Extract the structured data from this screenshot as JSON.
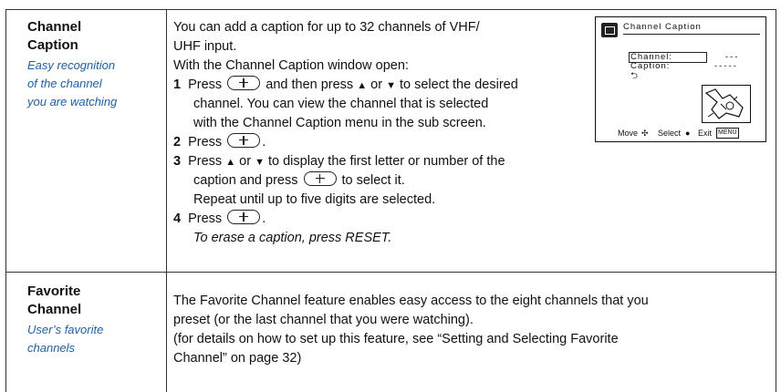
{
  "rows": [
    {
      "title_lines": [
        "Channel",
        "Caption"
      ],
      "subtitle_lines": [
        "Easy recognition",
        "of the channel",
        "you are watching"
      ],
      "intro_lines": [
        "You can add a caption for up to 32 channels of VHF/",
        "UHF input.",
        "With the Channel Caption window open:"
      ],
      "step1": {
        "num": "1",
        "press": "Press",
        "mid": "and then press",
        "or": "or",
        "end": "to select the desired",
        "line2": "channel. You can view the channel that is selected",
        "line3": "with the Channel Caption menu in the sub screen."
      },
      "step2": {
        "num": "2",
        "press": "Press",
        "end": "."
      },
      "step3": {
        "num": "3",
        "press": "Press",
        "or": "or",
        "end": "to display the first letter or number of the",
        "line2a": "caption and press",
        "line2b": "to select it.",
        "line3": "Repeat until up to five digits are selected."
      },
      "step4": {
        "num": "4",
        "press": "Press",
        "end": "."
      },
      "note": "To erase a caption, press RESET."
    },
    {
      "title_lines": [
        "Favorite",
        "Channel"
      ],
      "subtitle_lines": [
        "User’s favorite",
        "channels"
      ],
      "body_lines": [
        "The Favorite Channel feature enables easy access to the eight channels that you",
        "preset (or the last channel that you were watching).",
        "(for details on how to set up this feature, see “Setting and Selecting Favorite",
        "Channel” on page 32)"
      ]
    }
  ],
  "screen": {
    "title": "Channel Caption",
    "channel_label": "Channel:",
    "channel_value": "---",
    "caption_label": "Caption:",
    "caption_value": "-----",
    "footer_move": "Move",
    "footer_select": "Select",
    "footer_exit": "Exit",
    "footer_menu": "MENU"
  },
  "icons": [
    "enter-button-icon",
    "up-arrow-icon",
    "down-arrow-icon",
    "return-icon",
    "menu-icon",
    "tv-icon"
  ]
}
